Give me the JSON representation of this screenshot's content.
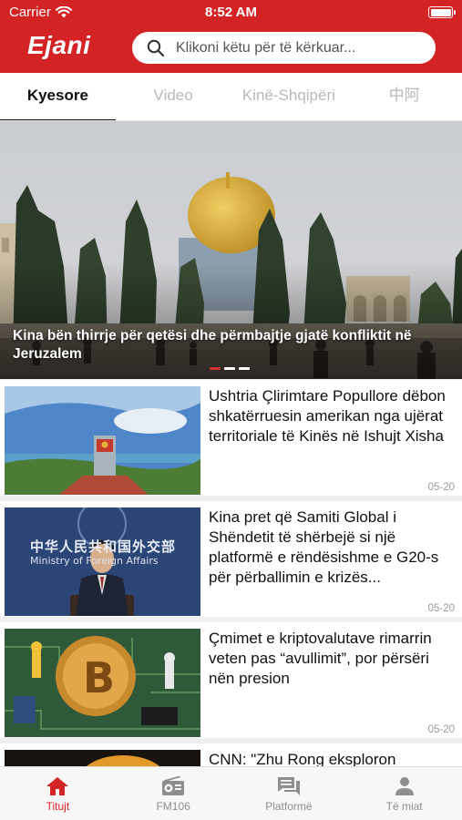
{
  "status_bar": {
    "carrier": "Carrier",
    "time": "8:52 AM"
  },
  "header": {
    "logo": "Ejani",
    "search_placeholder": "Klikoni këtu për të kërkuar..."
  },
  "tabs": [
    {
      "label": "Kyesore",
      "active": true
    },
    {
      "label": "Video",
      "active": false
    },
    {
      "label": "Kinë-Shqipëri",
      "active": false
    },
    {
      "label": "中阿",
      "active": false
    }
  ],
  "hero": {
    "caption": "Kina bën thirrje për qetësi dhe përmbajtje gjatë konfliktit në Jeruzalem"
  },
  "news": [
    {
      "title": "Ushtria Çlirimtare Popullore dëbon shkatërruesin amerikan nga ujërat territoriale të Kinës në Ishujt Xisha",
      "date": "05-20"
    },
    {
      "title": "Kina pret që Samiti Global i Shëndetit të shërbejë si një platformë e rëndësishme e G20-s për përballimin e krizës...",
      "date": "05-20"
    },
    {
      "title": "Çmimet e kriptovalutave rimarrin veten pas “avullimit”, por përsëri nën presion",
      "date": "05-20"
    },
    {
      "title": "CNN: \"Zhu Rong eksploron",
      "date": ""
    }
  ],
  "thumb_text": {
    "sign_line1": "中华人民共和国外交部",
    "sign_line2": "Ministry of Foreign Affairs"
  },
  "bottom_nav": [
    {
      "label": "Titujt",
      "icon": "home-icon",
      "active": true
    },
    {
      "label": "FM106",
      "icon": "radio-icon",
      "active": false
    },
    {
      "label": "Platformë",
      "icon": "chat-icon",
      "active": false
    },
    {
      "label": "Të miat",
      "icon": "person-icon",
      "active": false
    }
  ],
  "colors": {
    "brand": "#d32324",
    "inactive": "#8e8e8e"
  }
}
